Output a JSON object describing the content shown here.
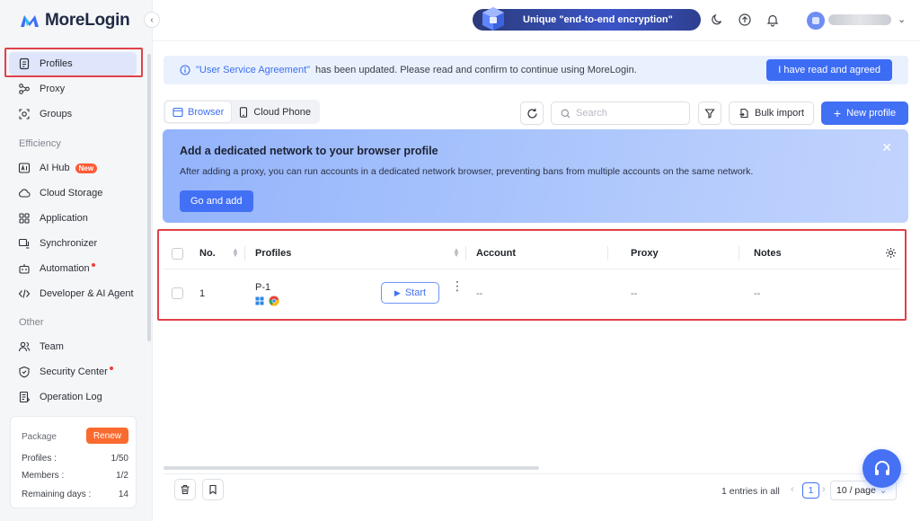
{
  "app": {
    "name": "MoreLogin"
  },
  "colors": {
    "accent": "#4270f5",
    "highlight": "#e0414a",
    "renew": "#fb6a2f",
    "new_badge": "#ff5a36"
  },
  "sidebar": {
    "main_items": [
      {
        "label": "Profiles",
        "icon": "document-icon",
        "active": true
      },
      {
        "label": "Proxy",
        "icon": "network-icon"
      },
      {
        "label": "Groups",
        "icon": "groups-icon"
      }
    ],
    "efficiency_title": "Efficiency",
    "efficiency_items": [
      {
        "label": "AI Hub",
        "icon": "ai-icon",
        "badge": "New"
      },
      {
        "label": "Cloud Storage",
        "icon": "cloud-icon"
      },
      {
        "label": "Application",
        "icon": "grid-icon"
      },
      {
        "label": "Synchronizer",
        "icon": "sync-icon"
      },
      {
        "label": "Automation",
        "icon": "robot-icon"
      },
      {
        "label": "Developer & AI Agent",
        "icon": "code-icon"
      }
    ],
    "other_title": "Other",
    "other_items": [
      {
        "label": "Team",
        "icon": "team-icon"
      },
      {
        "label": "Security Center",
        "icon": "shield-icon"
      },
      {
        "label": "Operation Log",
        "icon": "log-icon"
      }
    ],
    "package": {
      "title": "Package",
      "renew_label": "Renew",
      "rows": [
        {
          "label": "Profiles :",
          "value": "1/50"
        },
        {
          "label": "Members :",
          "value": "1/2"
        },
        {
          "label": "Remaining days :",
          "value": "14"
        }
      ]
    }
  },
  "topbar": {
    "promo_text": "Unique \"end-to-end encryption\"",
    "user_name": "n"
  },
  "notice": {
    "link_text": "\"User Service Agreement\"",
    "text": "has been updated. Please read and confirm to continue using MoreLogin.",
    "button_label": "I have read and agreed"
  },
  "toolbar": {
    "tabs": [
      {
        "label": "Browser",
        "active": true
      },
      {
        "label": "Cloud Phone"
      }
    ],
    "search_placeholder": "Search",
    "bulk_import_label": "Bulk import",
    "new_profile_label": "New profile"
  },
  "banner": {
    "title": "Add a dedicated network to your browser profile",
    "description": "After adding a proxy, you can run accounts in a dedicated network browser, preventing bans from multiple accounts on the same network.",
    "button_label": "Go and add"
  },
  "table": {
    "columns": {
      "no": "No.",
      "profiles": "Profiles",
      "account": "Account",
      "proxy": "Proxy",
      "notes": "Notes"
    },
    "rows": [
      {
        "no": "1",
        "name": "P-1",
        "start_label": "Start",
        "account": "--",
        "proxy": "--",
        "notes": "--"
      }
    ]
  },
  "pagination": {
    "entries_text": "1 entries in all",
    "current_page": "1",
    "page_size": "10 / page"
  }
}
